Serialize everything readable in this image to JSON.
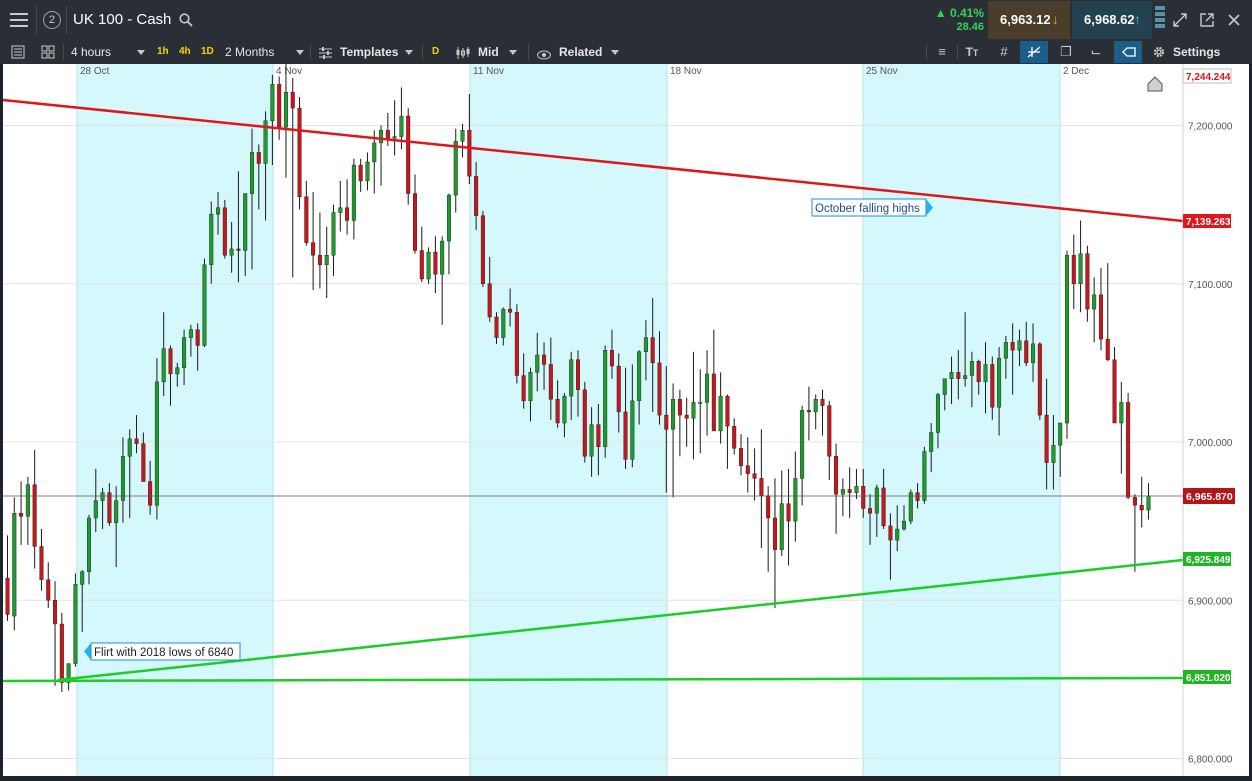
{
  "header": {
    "menu_icon": "hamburger-menu-icon",
    "layout_number": "2",
    "instrument": "UK 100 - Cash",
    "change_percent": "0.41%",
    "change_points": "28.46",
    "sell_price": "6,963.12",
    "buy_price": "6,968.62",
    "colors": {
      "sell_bg": "#4a3d2a",
      "buy_bg": "#24414f",
      "up": "#32d35a",
      "sell_arrow": "#f0a030",
      "buy_arrow": "#3bb6f5"
    }
  },
  "toolbar": {
    "interval": "4 hours",
    "quick_1h": "1h",
    "quick_4h": "4h",
    "quick_1d": "1D",
    "range": "2 Months",
    "templates": "Templates",
    "price_mode_badge": "D",
    "price_mode": "Mid",
    "related": "Related",
    "settings": "Settings"
  },
  "chart_data": {
    "type": "candlestick",
    "x_tick_labels": [
      "28 Oct",
      "4 Nov",
      "11 Nov",
      "18 Nov",
      "25 Nov",
      "2 Dec"
    ],
    "y_tick_labels": [
      "7,200.000",
      "7,100.000",
      "7,000.000",
      "6,900.000",
      "6,800.000"
    ],
    "ylim": [
      6795,
      7250
    ],
    "price_labels": {
      "top": "7,244.244",
      "resistance": "7,139.263",
      "current": "6,965.870",
      "support_trend": "6,925.849",
      "support_flat": "6,851.020"
    },
    "annotations": {
      "resistance": "October falling highs",
      "support": "Flirt with 2018 lows of 6840"
    },
    "colors": {
      "up": "#1f9a2c",
      "down": "#c8161d",
      "resistance": "#e0161b",
      "support": "#1ccc27",
      "shade": "#d4f8fb",
      "current_label": "#b3151b",
      "support_label": "#21b526"
    },
    "candles": [
      [
        6914,
        6941,
        6887,
        6891
      ],
      [
        6890,
        6965,
        6881,
        6955
      ],
      [
        6955,
        6975,
        6935,
        6953
      ],
      [
        6953,
        6978,
        6935,
        6973
      ],
      [
        6973,
        6995,
        6920,
        6934
      ],
      [
        6934,
        6945,
        6906,
        6913
      ],
      [
        6913,
        6924,
        6895,
        6900
      ],
      [
        6900,
        6912,
        6846,
        6885
      ],
      [
        6885,
        6892,
        6842,
        6848
      ],
      [
        6848,
        6860,
        6843,
        6860
      ],
      [
        6860,
        6917,
        6858,
        6910
      ],
      [
        6910,
        6919,
        6880,
        6918
      ],
      [
        6918,
        6954,
        6910,
        6952
      ],
      [
        6952,
        6983,
        6943,
        6963
      ],
      [
        6963,
        6971,
        6945,
        6968
      ],
      [
        6968,
        6974,
        6947,
        6949
      ],
      [
        6949,
        6972,
        6921,
        6963
      ],
      [
        6963,
        7003,
        6949,
        6991
      ],
      [
        6991,
        7008,
        6952,
        7002
      ],
      [
        7002,
        7017,
        6993,
        6999
      ],
      [
        6999,
        7006,
        6983,
        6975
      ],
      [
        6975,
        6988,
        6954,
        6960
      ],
      [
        6960,
        7053,
        6951,
        7038
      ],
      [
        7038,
        7082,
        7029,
        7059
      ],
      [
        7059,
        7061,
        7023,
        7043
      ],
      [
        7043,
        7050,
        7035,
        7047
      ],
      [
        7047,
        7071,
        7036,
        7066
      ],
      [
        7066,
        7074,
        7054,
        7071
      ],
      [
        7071,
        7075,
        7045,
        7061
      ],
      [
        7061,
        7116,
        7060,
        7112
      ],
      [
        7112,
        7152,
        7100,
        7144
      ],
      [
        7144,
        7158,
        7131,
        7148
      ],
      [
        7148,
        7153,
        7116,
        7118
      ],
      [
        7118,
        7139,
        7107,
        7122
      ],
      [
        7122,
        7171,
        7101,
        7121
      ],
      [
        7121,
        7157,
        7105,
        7157
      ],
      [
        7157,
        7198,
        7109,
        7183
      ],
      [
        7183,
        7188,
        7147,
        7176
      ],
      [
        7176,
        7209,
        7140,
        7203
      ],
      [
        7203,
        7232,
        7175,
        7226
      ],
      [
        7226,
        7231,
        7191,
        7199
      ],
      [
        7199,
        7241,
        7167,
        7221
      ],
      [
        7221,
        7230,
        7104,
        7211
      ],
      [
        7211,
        7218,
        7147,
        7155
      ],
      [
        7155,
        7165,
        7124,
        7126
      ],
      [
        7126,
        7158,
        7096,
        7118
      ],
      [
        7118,
        7145,
        7097,
        7112
      ],
      [
        7112,
        7136,
        7091,
        7118
      ],
      [
        7118,
        7150,
        7105,
        7145
      ],
      [
        7145,
        7165,
        7133,
        7148
      ],
      [
        7148,
        7166,
        7131,
        7140
      ],
      [
        7140,
        7179,
        7128,
        7175
      ],
      [
        7175,
        7179,
        7158,
        7165
      ],
      [
        7165,
        7183,
        7159,
        7177
      ],
      [
        7177,
        7197,
        7157,
        7189
      ],
      [
        7189,
        7200,
        7162,
        7197
      ],
      [
        7197,
        7208,
        7187,
        7192
      ],
      [
        7192,
        7216,
        7181,
        7193
      ],
      [
        7193,
        7224,
        7185,
        7206
      ],
      [
        7206,
        7211,
        7150,
        7157
      ],
      [
        7157,
        7169,
        7119,
        7121
      ],
      [
        7121,
        7136,
        7101,
        7103
      ],
      [
        7103,
        7123,
        7100,
        7120
      ],
      [
        7120,
        7130,
        7094,
        7106
      ],
      [
        7106,
        7130,
        7074,
        7127
      ],
      [
        7127,
        7157,
        7106,
        7156
      ],
      [
        7156,
        7198,
        7145,
        7190
      ],
      [
        7190,
        7201,
        7180,
        7197
      ],
      [
        7197,
        7220,
        7163,
        7168
      ],
      [
        7168,
        7177,
        7134,
        7143
      ],
      [
        7143,
        7146,
        7098,
        7100
      ],
      [
        7100,
        7117,
        7076,
        7079
      ],
      [
        7079,
        7082,
        7062,
        7066
      ],
      [
        7066,
        7085,
        7061,
        7084
      ],
      [
        7084,
        7097,
        7073,
        7082
      ],
      [
        7082,
        7087,
        7037,
        7042
      ],
      [
        7042,
        7056,
        7021,
        7026
      ],
      [
        7026,
        7047,
        7013,
        7044
      ],
      [
        7044,
        7069,
        7032,
        7055
      ],
      [
        7055,
        7063,
        7033,
        7049
      ],
      [
        7049,
        7066,
        7014,
        7027
      ],
      [
        7027,
        7039,
        7009,
        7012
      ],
      [
        7012,
        7031,
        7003,
        7029
      ],
      [
        7029,
        7057,
        7014,
        7052
      ],
      [
        7052,
        7058,
        7016,
        7033
      ],
      [
        7033,
        7038,
        6987,
        6991
      ],
      [
        6991,
        7022,
        6978,
        7011
      ],
      [
        7011,
        7024,
        6979,
        6997
      ],
      [
        6997,
        7061,
        6990,
        7058
      ],
      [
        7058,
        7071,
        7040,
        7048
      ],
      [
        7048,
        7056,
        7006,
        7019
      ],
      [
        7019,
        7047,
        6983,
        6989
      ],
      [
        6989,
        7049,
        6984,
        7026
      ],
      [
        7026,
        7058,
        7011,
        7057
      ],
      [
        7057,
        7077,
        7039,
        7066
      ],
      [
        7066,
        7091,
        7019,
        7050
      ],
      [
        7050,
        7070,
        7011,
        7017
      ],
      [
        7017,
        7048,
        6968,
        7008
      ],
      [
        7008,
        7037,
        6965,
        7027
      ],
      [
        7027,
        7033,
        6991,
        7017
      ],
      [
        7017,
        7028,
        6997,
        7015
      ],
      [
        7015,
        7057,
        6989,
        7025
      ],
      [
        7025,
        7046,
        6993,
        7025
      ],
      [
        7025,
        7058,
        7004,
        7043
      ],
      [
        7043,
        7071,
        7007,
        7007
      ],
      [
        7007,
        7044,
        6999,
        7029
      ],
      [
        7029,
        7030,
        6983,
        7010
      ],
      [
        7010,
        7015,
        6992,
        6996
      ],
      [
        6996,
        7005,
        6979,
        6985
      ],
      [
        6985,
        7003,
        6968,
        6980
      ],
      [
        6980,
        6996,
        6963,
        6977
      ],
      [
        6977,
        7008,
        6933,
        6966
      ],
      [
        6966,
        6972,
        6918,
        6952
      ],
      [
        6952,
        6977,
        6895,
        6932
      ],
      [
        6932,
        6982,
        6928,
        6961
      ],
      [
        6961,
        6983,
        6922,
        6950
      ],
      [
        6950,
        6994,
        6937,
        6977
      ],
      [
        6977,
        7023,
        6960,
        7020
      ],
      [
        7020,
        7035,
        7001,
        7019
      ],
      [
        7019,
        7030,
        7008,
        7027
      ],
      [
        7027,
        7033,
        7004,
        7023
      ],
      [
        7023,
        7026,
        6976,
        6991
      ],
      [
        6991,
        6999,
        6942,
        6967
      ],
      [
        6967,
        6977,
        6953,
        6970
      ],
      [
        6970,
        6984,
        6952,
        6968
      ],
      [
        6968,
        6983,
        6964,
        6972
      ],
      [
        6972,
        6983,
        6952,
        6958
      ],
      [
        6958,
        6967,
        6935,
        6955
      ],
      [
        6955,
        6973,
        6940,
        6971
      ],
      [
        6971,
        6983,
        6945,
        6947
      ],
      [
        6947,
        6955,
        6913,
        6938
      ],
      [
        6938,
        6960,
        6931,
        6945
      ],
      [
        6945,
        6960,
        6944,
        6950
      ],
      [
        6950,
        6970,
        6948,
        6968
      ],
      [
        6968,
        6974,
        6958,
        6963
      ],
      [
        6963,
        6997,
        6961,
        6994
      ],
      [
        6994,
        7012,
        6981,
        7006
      ],
      [
        7006,
        7031,
        6996,
        7030
      ],
      [
        7030,
        7038,
        7020,
        7040
      ],
      [
        7040,
        7054,
        7024,
        7044
      ],
      [
        7044,
        7058,
        7027,
        7040
      ],
      [
        7040,
        7082,
        7035,
        7042
      ],
      [
        7042,
        7057,
        7022,
        7051
      ],
      [
        7051,
        7052,
        7030,
        7038
      ],
      [
        7038,
        7063,
        7018,
        7049
      ],
      [
        7049,
        7054,
        7014,
        7022
      ],
      [
        7022,
        7060,
        7004,
        7053
      ],
      [
        7053,
        7067,
        7040,
        7063
      ],
      [
        7063,
        7075,
        7030,
        7058
      ],
      [
        7058,
        7071,
        7048,
        7064
      ],
      [
        7064,
        7076,
        7048,
        7050
      ],
      [
        7050,
        7075,
        7038,
        7062
      ],
      [
        7062,
        7063,
        7014,
        7017
      ],
      [
        7017,
        7040,
        6970,
        6987
      ],
      [
        6987,
        7017,
        6970,
        6998
      ],
      [
        6998,
        7012,
        6978,
        7012
      ],
      [
        7012,
        7121,
        7002,
        7118
      ],
      [
        7118,
        7131,
        7084,
        7100
      ],
      [
        7100,
        7140,
        7082,
        7119
      ],
      [
        7119,
        7124,
        7076,
        7084
      ],
      [
        7084,
        7104,
        7063,
        7093
      ],
      [
        7093,
        7110,
        7058,
        7065
      ],
      [
        7065,
        7113,
        7051,
        7052
      ],
      [
        7052,
        7060,
        7016,
        7012
      ],
      [
        7012,
        7038,
        6980,
        7025
      ],
      [
        7025,
        7031,
        6964,
        6965
      ],
      [
        6965,
        6967,
        6918,
        6960
      ],
      [
        6960,
        6978,
        6946,
        6957
      ],
      [
        6957,
        6974,
        6951,
        6966
      ]
    ]
  }
}
